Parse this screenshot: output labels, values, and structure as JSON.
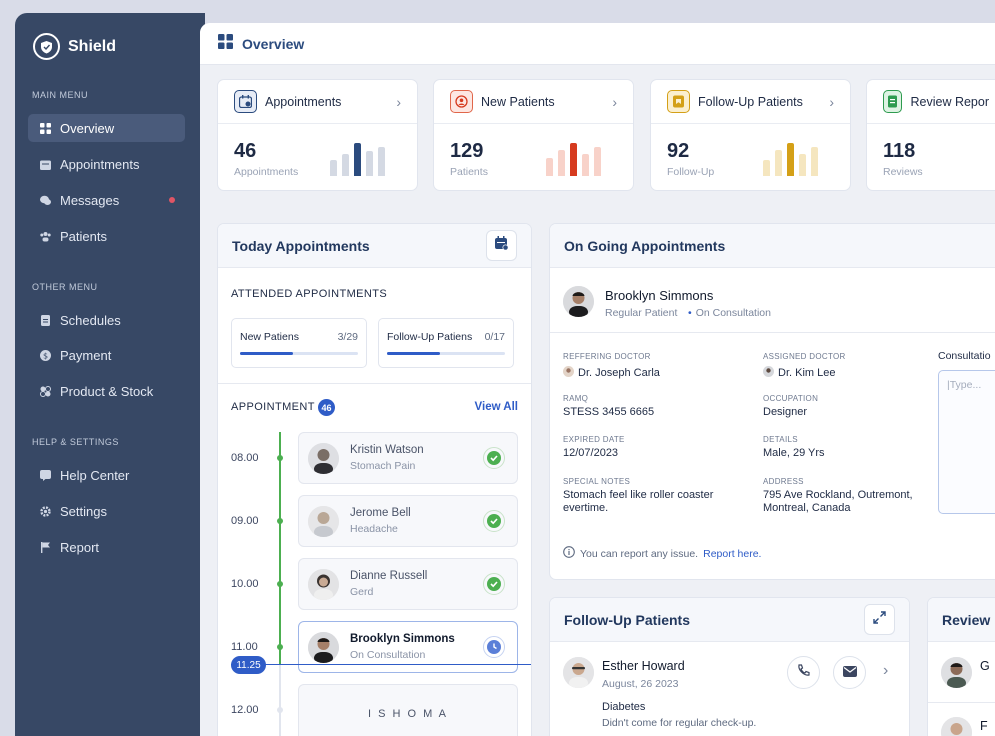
{
  "brand": {
    "name": "Shield"
  },
  "sidebar": {
    "sections": [
      {
        "title": "MAIN MENU",
        "items": [
          {
            "label": "Overview",
            "icon": "grid-icon"
          },
          {
            "label": "Appointments",
            "icon": "calendar-icon"
          },
          {
            "label": "Messages",
            "icon": "chat-icon"
          },
          {
            "label": "Patients",
            "icon": "users-icon"
          }
        ]
      },
      {
        "title": "OTHER MENU",
        "items": [
          {
            "label": "Schedules",
            "icon": "document-icon"
          },
          {
            "label": "Payment",
            "icon": "dollar-icon"
          },
          {
            "label": "Product & Stock",
            "icon": "box-icon"
          }
        ]
      },
      {
        "title": "HELP & SETTINGS",
        "items": [
          {
            "label": "Help Center",
            "icon": "help-icon"
          },
          {
            "label": "Settings",
            "icon": "gear-icon"
          },
          {
            "label": "Report",
            "icon": "flag-icon"
          }
        ]
      }
    ]
  },
  "topbar": {
    "title": "Overview"
  },
  "stats": [
    {
      "title": "Appointments",
      "value": "46",
      "sub": "Appointments",
      "color": "#2b4b7e",
      "accent_bg": "#e7ecf6"
    },
    {
      "title": "New Patients",
      "value": "129",
      "sub": "Patients",
      "color": "#d63b1f",
      "accent_bg": "#fde7e2"
    },
    {
      "title": "Follow-Up Patients",
      "value": "92",
      "sub": "Follow-Up",
      "color": "#d4a017",
      "accent_bg": "#fbefcf"
    },
    {
      "title": "Review Repor",
      "value": "118",
      "sub": "Reviews",
      "color": "#2e9b4f",
      "accent_bg": "#def3e3"
    }
  ],
  "today": {
    "title": "Today Appointments",
    "attended_title": "ATTENDED APPOINTMENTS",
    "cards": [
      {
        "label": "New Patiens",
        "count": "3/29",
        "progress": 0.45
      },
      {
        "label": "Follow-Up Patiens",
        "count": "0/17",
        "progress": 0.45
      }
    ],
    "appointment_label": "APPOINTMENT",
    "appointment_count": "46",
    "view_all": "View All",
    "current_time": "11.25",
    "items": [
      {
        "time": "08.00",
        "name": "Kristin Watson",
        "sub": "Stomach Pain",
        "status": "done"
      },
      {
        "time": "09.00",
        "name": "Jerome Bell",
        "sub": "Headache",
        "status": "done"
      },
      {
        "time": "10.00",
        "name": "Dianne Russell",
        "sub": "Gerd",
        "status": "done"
      },
      {
        "time": "11.00",
        "name": "Brooklyn Simmons",
        "sub": "On Consultation",
        "status": "current"
      },
      {
        "time": "12.00",
        "name": "",
        "sub": "",
        "status": "break",
        "break_label": "I S H O M A"
      }
    ]
  },
  "ongoing": {
    "title": "On Going Appointments",
    "patient_name": "Brooklyn Simmons",
    "patient_type": "Regular Patient",
    "patient_status": "On Consultation",
    "fields": [
      {
        "label": "REFFERING DOCTOR",
        "value": "Dr. Joseph Carla"
      },
      {
        "label": "ASSIGNED DOCTOR",
        "value": "Dr. Kim Lee"
      },
      {
        "label": "RAMQ",
        "value": "STESS 3455 6665"
      },
      {
        "label": "OCCUPATION",
        "value": "Designer"
      },
      {
        "label": "EXPIRED DATE",
        "value": "12/07/2023"
      },
      {
        "label": "DETAILS",
        "value": "Male, 29 Yrs"
      },
      {
        "label": "SPECIAL NOTES",
        "value": "Stomach feel like roller coaster evertime."
      },
      {
        "label": "ADDRESS",
        "value": "795 Ave Rockland, Outremont, Montreal, Canada"
      }
    ],
    "consult_label": "Consultatio",
    "consult_placeholder": "|Type...",
    "report_text": "You can report any issue.",
    "report_link": "Report here."
  },
  "followup": {
    "title": "Follow-Up Patients",
    "name": "Esther Howard",
    "date": "August, 26 2023",
    "condition": "Diabetes",
    "note": "Didn't come for regular check-up."
  },
  "reviews": {
    "title": "Review",
    "first_initial": "G",
    "second_initial": "F"
  }
}
